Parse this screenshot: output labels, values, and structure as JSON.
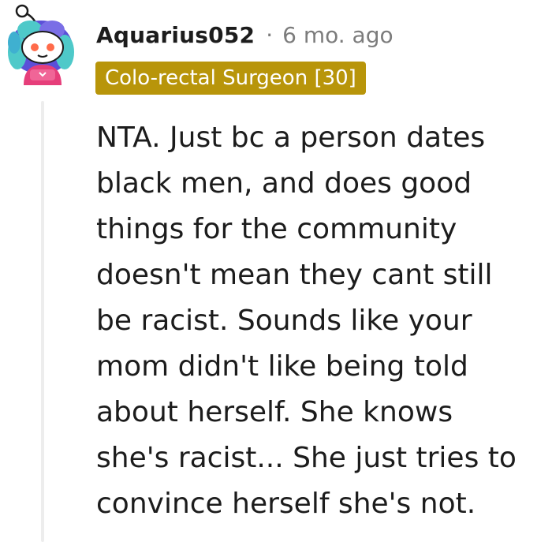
{
  "comment": {
    "author": "Aquarius052",
    "separator": "·",
    "timestamp": "6 mo. ago",
    "flair": "Colo-rectal Surgeon [30]",
    "body_lines": [
      "NTA. Just bc a person dates",
      "black men, and does good",
      "things for the community",
      "doesn't mean they cant still",
      "be racist. Sounds like your",
      "mom didn't like being told",
      "about herself. She knows",
      "she's racist... She just tries to",
      "convince herself she's not."
    ]
  },
  "icons": {
    "avatar": "snoo-avatar-icon"
  },
  "colors": {
    "flair_background": "#b8950a",
    "flair_text": "#ffffff",
    "meta_text": "#7c7c7c",
    "thread_line": "#ededed"
  }
}
